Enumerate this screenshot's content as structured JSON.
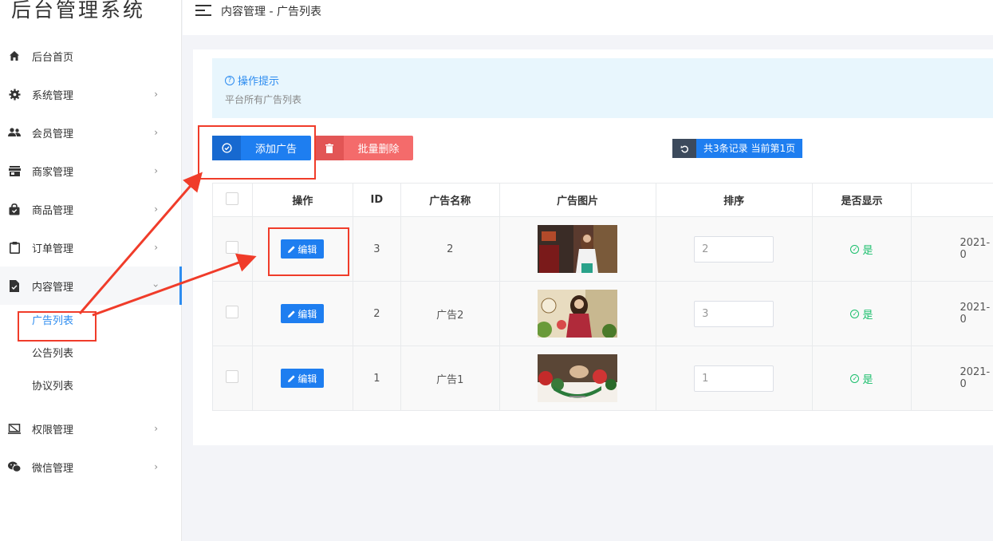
{
  "sidebar": {
    "logo": "后台管理系统",
    "menu": [
      {
        "label": "后台首页",
        "icon": "home-icon"
      },
      {
        "label": "系统管理",
        "icon": "gear-icon"
      },
      {
        "label": "会员管理",
        "icon": "users-icon"
      },
      {
        "label": "商家管理",
        "icon": "store-icon"
      },
      {
        "label": "商品管理",
        "icon": "bag-icon"
      },
      {
        "label": "订单管理",
        "icon": "clipboard-icon"
      },
      {
        "label": "内容管理",
        "icon": "document-icon"
      }
    ],
    "submenu": [
      "广告列表",
      "公告列表",
      "协议列表"
    ],
    "menu_after": [
      {
        "label": "权限管理",
        "icon": "monitor-icon"
      },
      {
        "label": "微信管理",
        "icon": "wechat-icon"
      }
    ]
  },
  "header": {
    "breadcrumb": "内容管理 - 广告列表"
  },
  "tip": {
    "title": "操作提示",
    "desc": "平台所有广告列表"
  },
  "toolbar": {
    "add_label": "添加广告",
    "batch_delete_label": "批量删除",
    "record_info": "共3条记录 当前第1页"
  },
  "table": {
    "headers": [
      "操作",
      "ID",
      "广告名称",
      "广告图片",
      "排序",
      "是否显示"
    ],
    "edit_label": "编辑",
    "shown_label": "是",
    "rows": [
      {
        "id": "3",
        "name": "2",
        "sort": "2",
        "date": "2021-0"
      },
      {
        "id": "2",
        "name": "广告2",
        "sort": "3",
        "date": "2021-0"
      },
      {
        "id": "1",
        "name": "广告1",
        "sort": "1",
        "date": "2021-0"
      }
    ]
  },
  "colors": {
    "primary": "#1e7ef0",
    "danger": "#f46b6b",
    "success": "#19be6b",
    "annotation": "#f03c2a"
  }
}
